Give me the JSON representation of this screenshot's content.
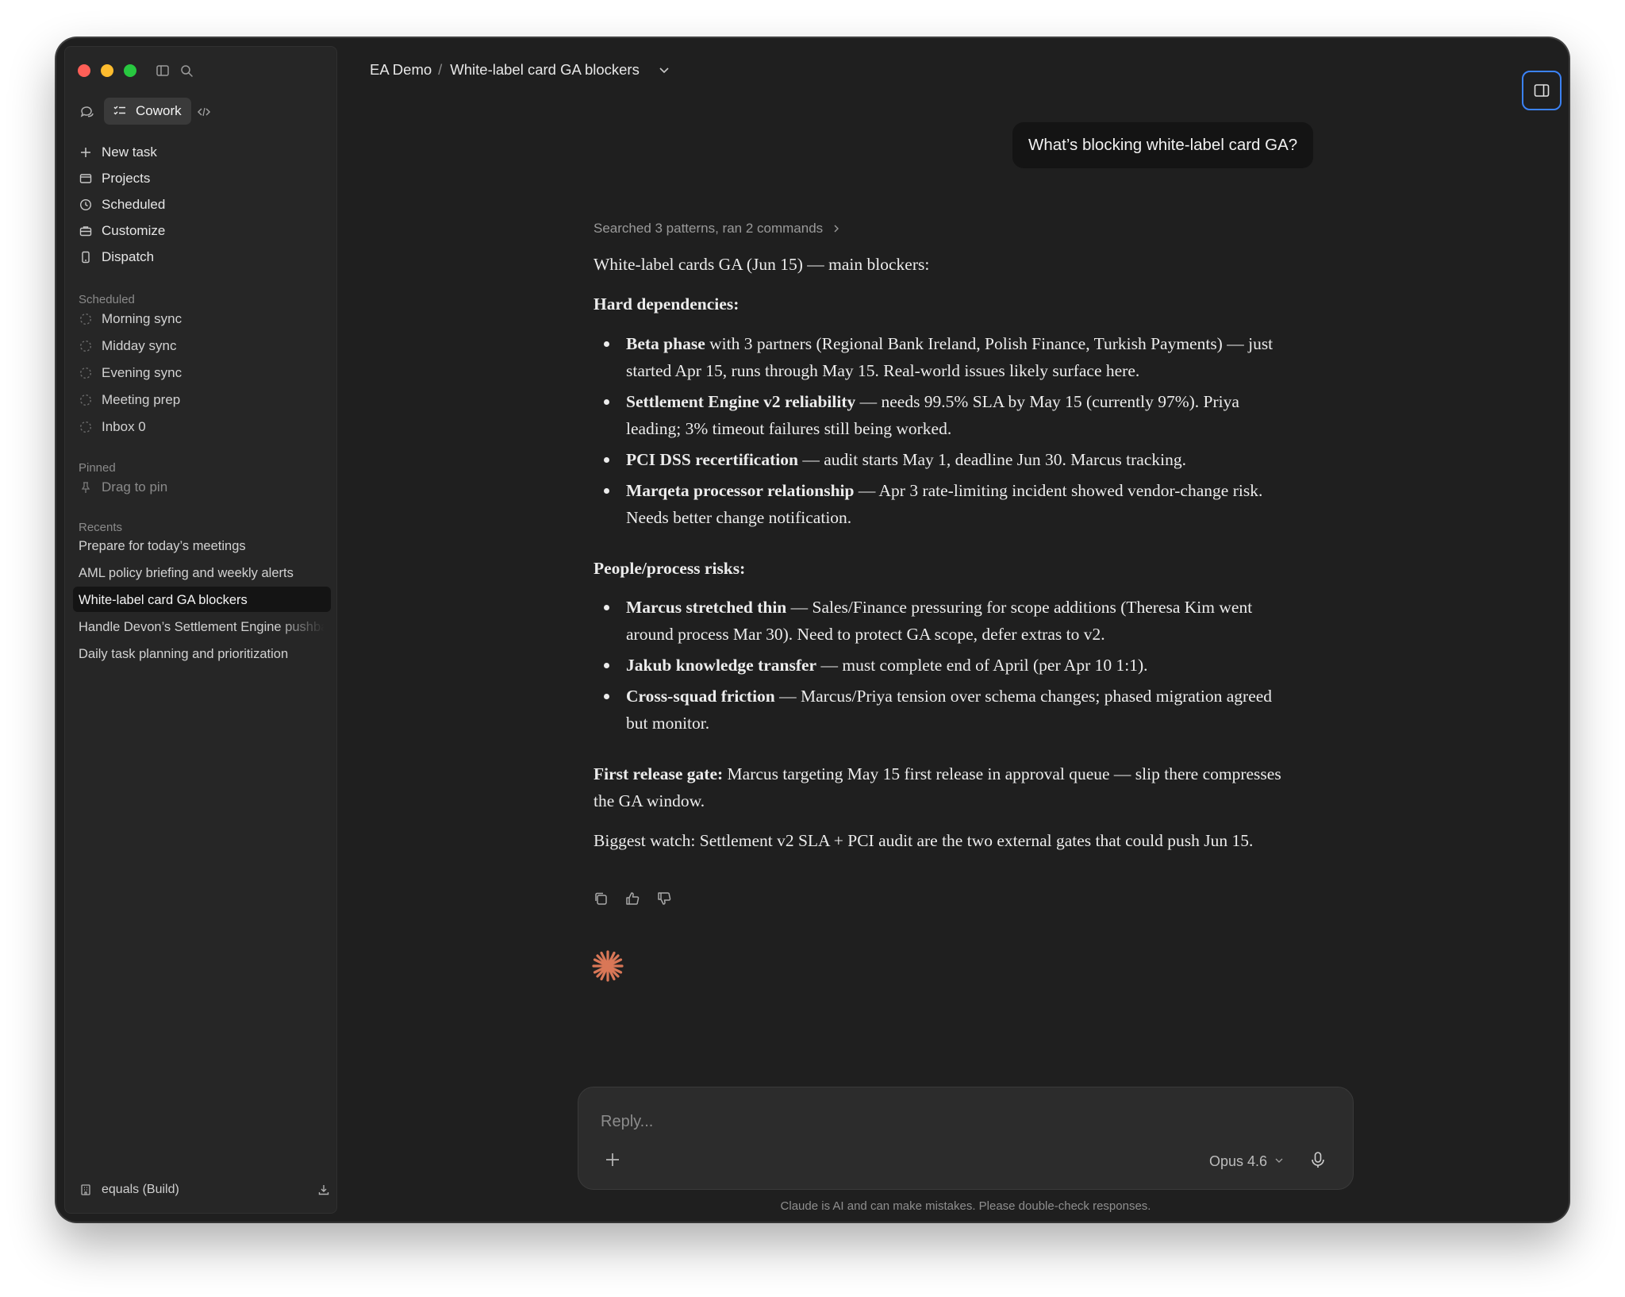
{
  "breadcrumb": {
    "workspace": "EA Demo",
    "separator": "/",
    "title": "White-label card GA blockers"
  },
  "sidebar": {
    "mode_label": "Cowork",
    "nav": [
      {
        "label": "New task",
        "icon": "plus-icon"
      },
      {
        "label": "Projects",
        "icon": "folder-icon"
      },
      {
        "label": "Scheduled",
        "icon": "clock-icon"
      },
      {
        "label": "Customize",
        "icon": "briefcase-icon"
      },
      {
        "label": "Dispatch",
        "icon": "phone-icon"
      }
    ],
    "scheduled_heading": "Scheduled",
    "scheduled": [
      "Morning sync",
      "Midday sync",
      "Evening sync",
      "Meeting prep",
      "Inbox 0"
    ],
    "pinned_heading": "Pinned",
    "pinned_placeholder": "Drag to pin",
    "recents_heading": "Recents",
    "recents": [
      "Prepare for today’s meetings",
      "AML policy briefing and weekly alerts",
      "White-label card GA blockers",
      "Handle Devon’s Settlement Engine pushback",
      "Daily task planning and prioritization"
    ],
    "active_recent": "White-label card GA blockers",
    "footer_label": "equals (Build)"
  },
  "chat": {
    "user_message": "What’s blocking white-label card GA?",
    "tool_summary": "Searched 3 patterns, ran 2 commands",
    "intro": "White-label cards GA (Jun 15) — main blockers:",
    "hard_heading": "Hard dependencies:",
    "hard": [
      {
        "bold": "Beta phase",
        "text": " with 3 partners (Regional Bank Ireland, Polish Finance, Turkish Payments) — just started Apr 15, runs through May 15. Real-world issues likely surface here."
      },
      {
        "bold": "Settlement Engine v2 reliability",
        "text": " — needs 99.5% SLA by May 15 (currently 97%). Priya leading; 3% timeout failures still being worked."
      },
      {
        "bold": "PCI DSS recertification",
        "text": " — audit starts May 1, deadline Jun 30. Marcus tracking."
      },
      {
        "bold": "Marqeta processor relationship",
        "text": " — Apr 3 rate-limiting incident showed vendor-change risk. Needs better change notification."
      }
    ],
    "people_heading": "People/process risks:",
    "people": [
      {
        "bold": "Marcus stretched thin",
        "text": " — Sales/Finance pressuring for scope additions (Theresa Kim went around process Mar 30). Need to protect GA scope, defer extras to v2."
      },
      {
        "bold": "Jakub knowledge transfer",
        "text": " — must complete end of April (per Apr 10 1:1)."
      },
      {
        "bold": "Cross-squad friction",
        "text": " — Marcus/Priya tension over schema changes; phased migration agreed but monitor."
      }
    ],
    "gate_bold": "First release gate:",
    "gate_text": " Marcus targeting May 15 first release in approval queue — slip there compresses the GA window.",
    "summary": "Biggest watch: Settlement v2 SLA + PCI audit are the two external gates that could push Jun 15."
  },
  "composer": {
    "placeholder": "Reply...",
    "model": "Opus 4.6"
  },
  "disclaimer": "Claude is AI and can make mistakes. Please double-check responses.",
  "colors": {
    "window_bg": "#1f1f1f",
    "sidebar_bg": "#262626",
    "accent_blue": "#3b82f6",
    "spark_orange": "#d97757",
    "traffic_red": "#fe5f57",
    "traffic_yellow": "#febc2e",
    "traffic_green": "#28c840"
  }
}
